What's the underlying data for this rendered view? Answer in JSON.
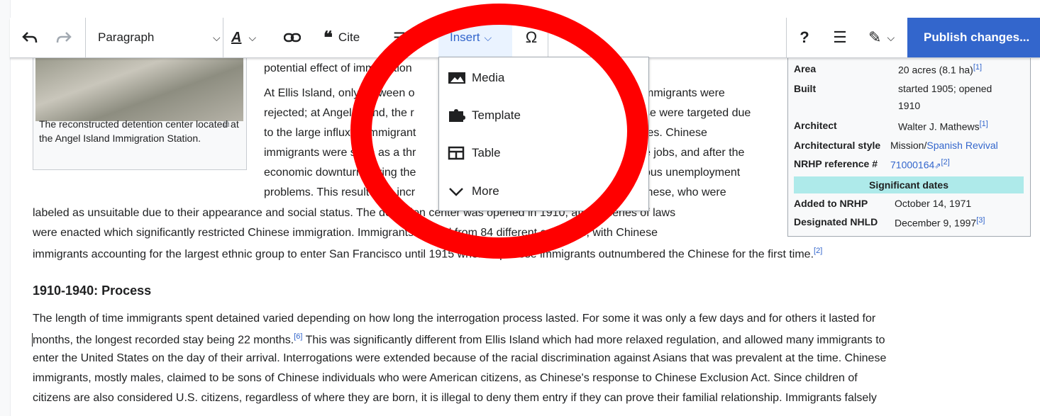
{
  "toolbar": {
    "paragraph_label": "Paragraph",
    "cite_label": "Cite",
    "insert_label": "Insert",
    "help_label": "?",
    "publish_label": "Publish changes..."
  },
  "insert_menu": {
    "items": [
      {
        "label": "Media",
        "icon": "media-icon"
      },
      {
        "label": "Template",
        "icon": "puzzle-icon"
      },
      {
        "label": "Table",
        "icon": "table-icon"
      },
      {
        "label": "More",
        "icon": "chevron-down-icon"
      }
    ]
  },
  "thumb": {
    "caption": "The reconstructed detention center located at the Angel Island Immigration Station."
  },
  "article": {
    "lines": [
      "potential effect of immigration",
      "At Ellis Island, only between o",
      "mmigrants were",
      "rejected; at Angel Island, the r",
      "se were targeted due",
      "to the large influx of immigrant",
      "tes. Chinese",
      "immigrants were seen as a thr",
      "e jobs, and after the",
      "economic downturn during the",
      "ous unemployment",
      "problems. This resulted in incr",
      "inese, who were",
      "labeled as unsuitable due to their appearance and social status. The detention center was opened in 1910, after a series of laws",
      "were enacted which significantly restricted Chinese immigration. Immigrants arrived from 84 different countries, with Chinese",
      "immigrants accounting for the largest ethnic group to enter San Francisco until 1915 when Japanese immigrants outnumbered the Chinese for the first time."
    ],
    "ref2": "[2]",
    "heading": "1910-1940: Process",
    "para2": [
      "The length of time immigrants spent detained varied depending on how long the interrogation process lasted. For some it was only a few days and for others it lasted for",
      "months, the longest recorded stay being 22 months.",
      " This was significantly different from Ellis Island which had more relaxed regulation, and allowed many immigrants to",
      "enter the United States on the day of their arrival. Interrogations were extended because of the racial discrimination against Asians that was prevalent at the time. Chinese",
      "immigrants, mostly males, claimed to be sons of Chinese individuals who were American citizens,  as Chinese's response to Chinese Exclusion Act. Since children of",
      "citizens are also considered U.S. citizens, regardless of where they are born, it is illegal to deny them entry if they can prove their familial relationship. Immigrants falsely"
    ],
    "ref6": "[6]"
  },
  "infobox": {
    "area_label": "Area",
    "area_value": "20 acres (8.1 ha)",
    "area_ref": "[1]",
    "built_label": "Built",
    "built_value_1": "started 1905; opened",
    "built_value_2": "1910",
    "architect_label": "Architect",
    "architect_value": "Walter J. Mathews",
    "architect_ref": "[1]",
    "style_label": "Architectural style",
    "style_value_a": "Mission/",
    "style_value_b": "Spanish Revival",
    "nrhp_label": "NRHP reference #",
    "nrhp_value": "71000164",
    "nrhp_ref": "[2]",
    "sig_header": "Significant dates",
    "added_label": "Added to NRHP",
    "added_value": "October 14, 1971",
    "designated_label": "Designated NHLD",
    "designated_value": "December 9, 1997",
    "designated_ref": "[3]"
  },
  "colors": {
    "accent": "#3366cc",
    "annotation_ring": "#ff0000",
    "infobox_header": "#aeeaea"
  }
}
